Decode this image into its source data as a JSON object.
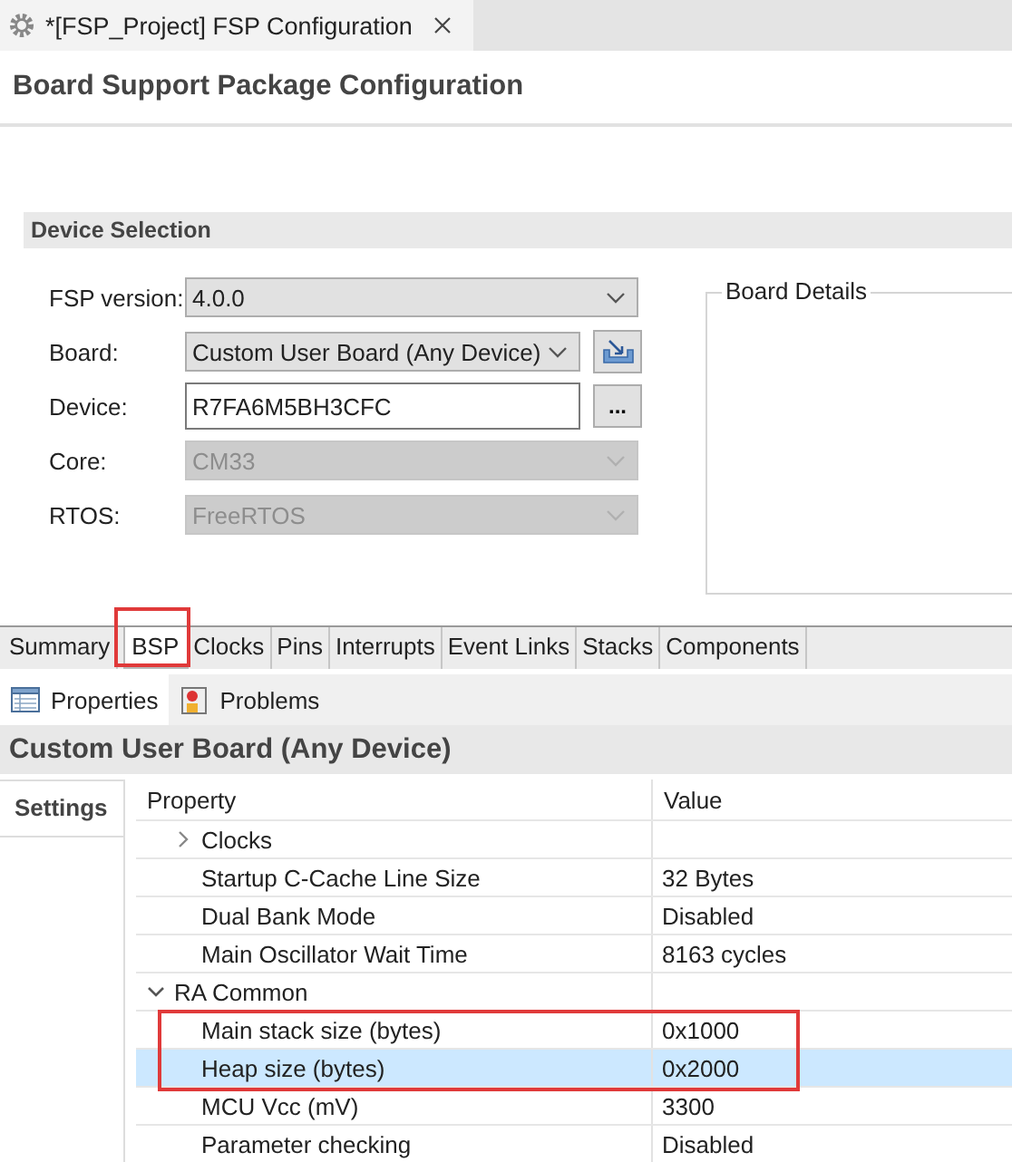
{
  "editor_tab": {
    "title": "*[FSP_Project] FSP Configuration"
  },
  "page_title": "Board Support Package Configuration",
  "device_selection": {
    "title": "Device Selection",
    "fields": [
      {
        "label": "FSP version:",
        "kind": "combo",
        "value": "4.0.0",
        "disabled": false
      },
      {
        "label": "Board:",
        "kind": "combo",
        "value": "Custom User Board (Any Device)",
        "disabled": false,
        "action": {
          "kind": "import"
        }
      },
      {
        "label": "Device:",
        "kind": "text",
        "value": "R7FA6M5BH3CFC",
        "disabled": false,
        "action": {
          "kind": "browse",
          "label": "..."
        }
      },
      {
        "label": "Core:",
        "kind": "combo",
        "value": "CM33",
        "disabled": true
      },
      {
        "label": "RTOS:",
        "kind": "combo",
        "value": "FreeRTOS",
        "disabled": true
      }
    ],
    "board_details": {
      "title": "Board Details"
    }
  },
  "config_tabs": [
    {
      "label": "Summary",
      "selected": false,
      "highlighted": false
    },
    {
      "label": "BSP",
      "selected": true,
      "highlighted": true
    },
    {
      "label": "Clocks",
      "selected": false,
      "highlighted": false
    },
    {
      "label": "Pins",
      "selected": false,
      "highlighted": false
    },
    {
      "label": "Interrupts",
      "selected": false,
      "highlighted": false
    },
    {
      "label": "Event Links",
      "selected": false,
      "highlighted": false
    },
    {
      "label": "Stacks",
      "selected": false,
      "highlighted": false
    },
    {
      "label": "Components",
      "selected": false,
      "highlighted": false
    }
  ],
  "views": [
    {
      "label": "Properties",
      "kind": "properties",
      "selected": true
    },
    {
      "label": "Problems",
      "kind": "problems",
      "selected": false
    }
  ],
  "properties": {
    "title": "Custom User Board (Any Device)",
    "side_tabs": [
      {
        "label": "Settings"
      }
    ],
    "columns": [
      "Property",
      "Value"
    ],
    "tree": [
      {
        "children": [
          {
            "label": "Clocks",
            "expanded": false,
            "selected": false,
            "highlighted": false
          },
          {
            "label": "Startup C-Cache Line Size",
            "value": "32 Bytes",
            "selected": false,
            "highlighted": false
          },
          {
            "label": "Dual Bank Mode",
            "value": "Disabled",
            "selected": false,
            "highlighted": false
          },
          {
            "label": "Main Oscillator Wait Time",
            "value": "8163 cycles",
            "selected": false,
            "highlighted": false
          }
        ]
      },
      {
        "label": "RA Common",
        "expanded": true,
        "selected": false,
        "highlighted": false,
        "children": [
          {
            "label": "Main stack size (bytes)",
            "value": "0x1000",
            "selected": false,
            "highlighted": true
          },
          {
            "label": "Heap size (bytes)",
            "value": "0x2000",
            "selected": true,
            "highlighted": true
          },
          {
            "label": "MCU Vcc (mV)",
            "value": "3300",
            "selected": false,
            "highlighted": false
          },
          {
            "label": "Parameter checking",
            "value": "Disabled",
            "selected": false,
            "highlighted": false
          }
        ]
      }
    ]
  }
}
